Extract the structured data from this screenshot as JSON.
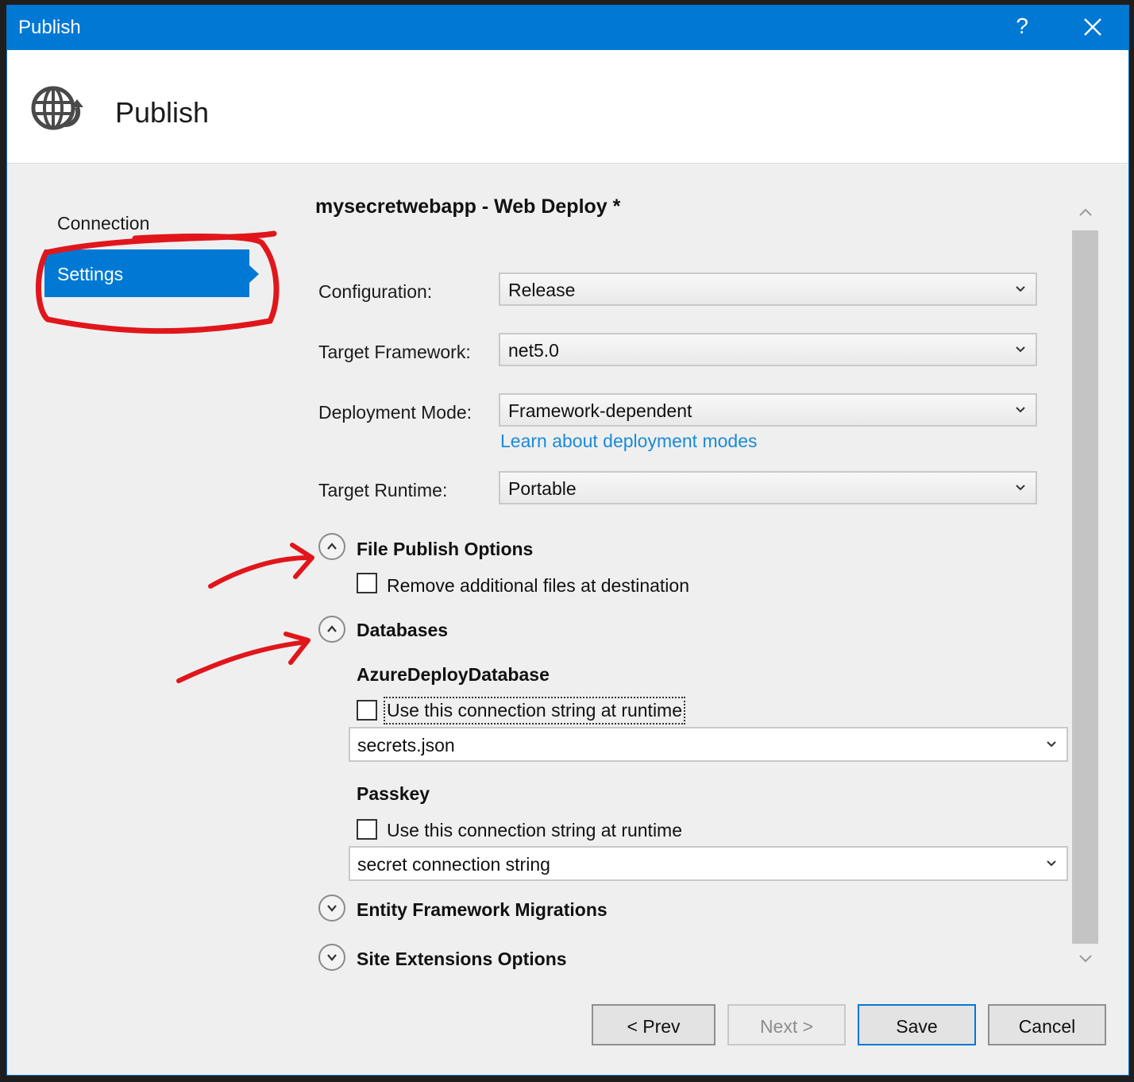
{
  "window": {
    "title": "Publish",
    "help_label": "?"
  },
  "header": {
    "title": "Publish",
    "icon": "globe-publish-icon"
  },
  "nav": {
    "items": [
      {
        "label": "Connection"
      },
      {
        "label": "Settings"
      }
    ]
  },
  "profile_title": "mysecretwebapp - Web Deploy *",
  "settings": {
    "configuration": {
      "label": "Configuration:",
      "value": "Release"
    },
    "target_framework": {
      "label": "Target Framework:",
      "value": "net5.0"
    },
    "deployment_mode": {
      "label": "Deployment Mode:",
      "value": "Framework-dependent",
      "link": "Learn about deployment modes"
    },
    "target_runtime": {
      "label": "Target Runtime:",
      "value": "Portable"
    }
  },
  "sections": {
    "file_publish": {
      "title": "File Publish Options",
      "checkbox_label": "Remove additional files at destination",
      "checked": false,
      "expanded": true
    },
    "databases": {
      "title": "Databases",
      "expanded": true,
      "items": [
        {
          "name": "AzureDeployDatabase",
          "checkbox_label": "Use this connection string at runtime",
          "checked": false,
          "value": "secrets.json"
        },
        {
          "name": "Passkey",
          "checkbox_label": "Use this connection string at runtime",
          "checked": false,
          "value": "secret connection string"
        }
      ]
    },
    "ef_migrations": {
      "title": "Entity Framework Migrations",
      "expanded": false
    },
    "site_extensions": {
      "title": "Site Extensions Options",
      "expanded": false
    }
  },
  "buttons": {
    "prev": "< Prev",
    "next": "Next >",
    "save": "Save",
    "cancel": "Cancel"
  },
  "colors": {
    "accent": "#0078d4",
    "link": "#1a8ad8",
    "annotation": "#e0161b"
  }
}
